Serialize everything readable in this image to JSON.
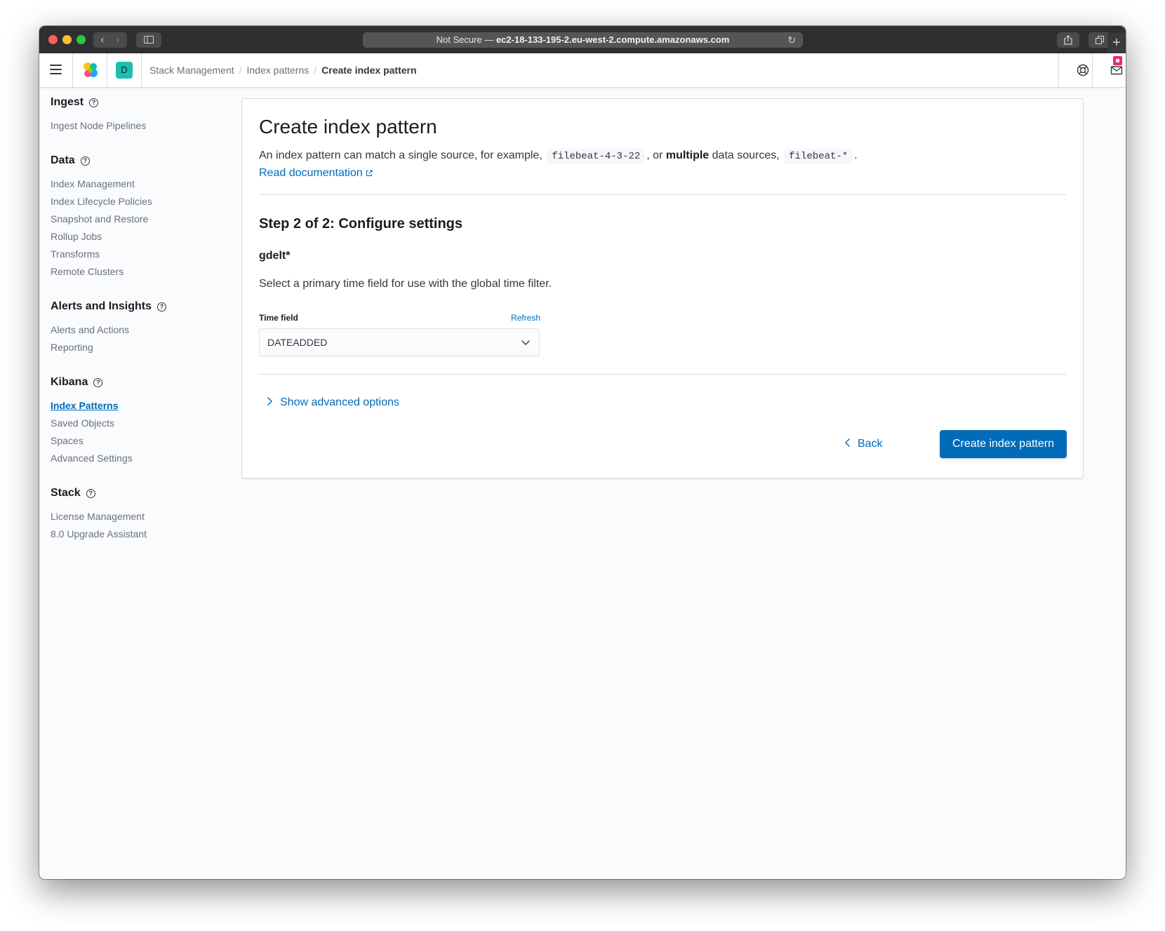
{
  "browser": {
    "url_prefix": "Not Secure —",
    "url_host": "ec2-18-133-195-2.eu-west-2.compute.amazonaws.com"
  },
  "header": {
    "space_initial": "D",
    "breadcrumbs": [
      "Stack Management",
      "Index patterns",
      "Create index pattern"
    ]
  },
  "sidebar": {
    "groups": [
      {
        "title": "Ingest",
        "items": [
          "Ingest Node Pipelines"
        ]
      },
      {
        "title": "Data",
        "items": [
          "Index Management",
          "Index Lifecycle Policies",
          "Snapshot and Restore",
          "Rollup Jobs",
          "Transforms",
          "Remote Clusters"
        ]
      },
      {
        "title": "Alerts and Insights",
        "items": [
          "Alerts and Actions",
          "Reporting"
        ]
      },
      {
        "title": "Kibana",
        "items": [
          "Index Patterns",
          "Saved Objects",
          "Spaces",
          "Advanced Settings"
        ]
      },
      {
        "title": "Stack",
        "items": [
          "License Management",
          "8.0 Upgrade Assistant"
        ]
      }
    ],
    "active_item": "Index Patterns"
  },
  "panel": {
    "title": "Create index pattern",
    "desc_prefix": "An index pattern can match a single source, for example,",
    "desc_example1": "filebeat-4-3-22",
    "desc_middle1": ", or",
    "desc_bold": "multiple",
    "desc_middle2": "data sources,",
    "desc_example2": "filebeat-*",
    "desc_end": ".",
    "doc_link": "Read documentation",
    "step_title": "Step 2 of 2: Configure settings",
    "index_pattern": "gdelt*",
    "select_text": "Select a primary time field for use with the global time filter.",
    "time_field_label": "Time field",
    "refresh_label": "Refresh",
    "time_field_value": "DATEADDED",
    "advanced_label": "Show advanced options",
    "back_label": "Back",
    "create_label": "Create index pattern"
  }
}
